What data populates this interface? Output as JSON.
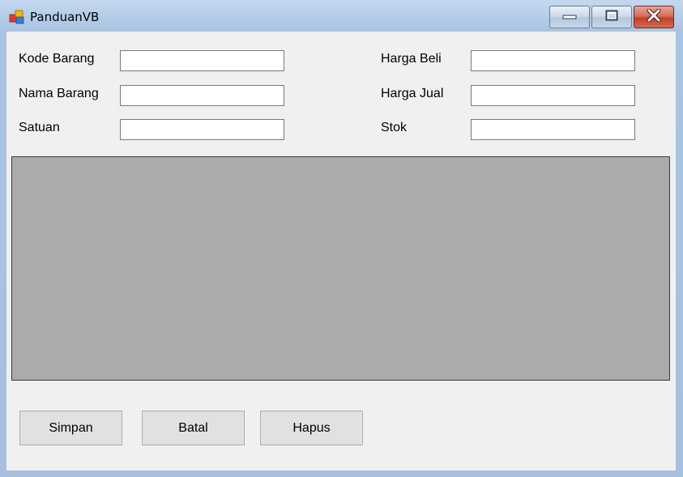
{
  "window": {
    "title": "PanduanVB",
    "icon": "app-window-icon",
    "controls": {
      "minimize": "minimize-icon",
      "maximize": "maximize-icon",
      "close": "close-icon"
    }
  },
  "form": {
    "left_fields": [
      {
        "label": "Kode Barang",
        "value": ""
      },
      {
        "label": "Nama Barang",
        "value": ""
      },
      {
        "label": "Satuan",
        "value": ""
      }
    ],
    "right_fields": [
      {
        "label": "Harga Beli",
        "value": ""
      },
      {
        "label": "Harga Jual",
        "value": ""
      },
      {
        "label": "Stok",
        "value": ""
      }
    ]
  },
  "grid": {
    "rows": []
  },
  "buttons": {
    "save": "Simpan",
    "cancel": "Batal",
    "delete": "Hapus"
  },
  "colors": {
    "title_bar": "#a9c3e2",
    "client_background": "#f0f0f0",
    "grid_background": "#ababab",
    "close_button": "#c0402a",
    "button_face": "#e1e1e1"
  }
}
